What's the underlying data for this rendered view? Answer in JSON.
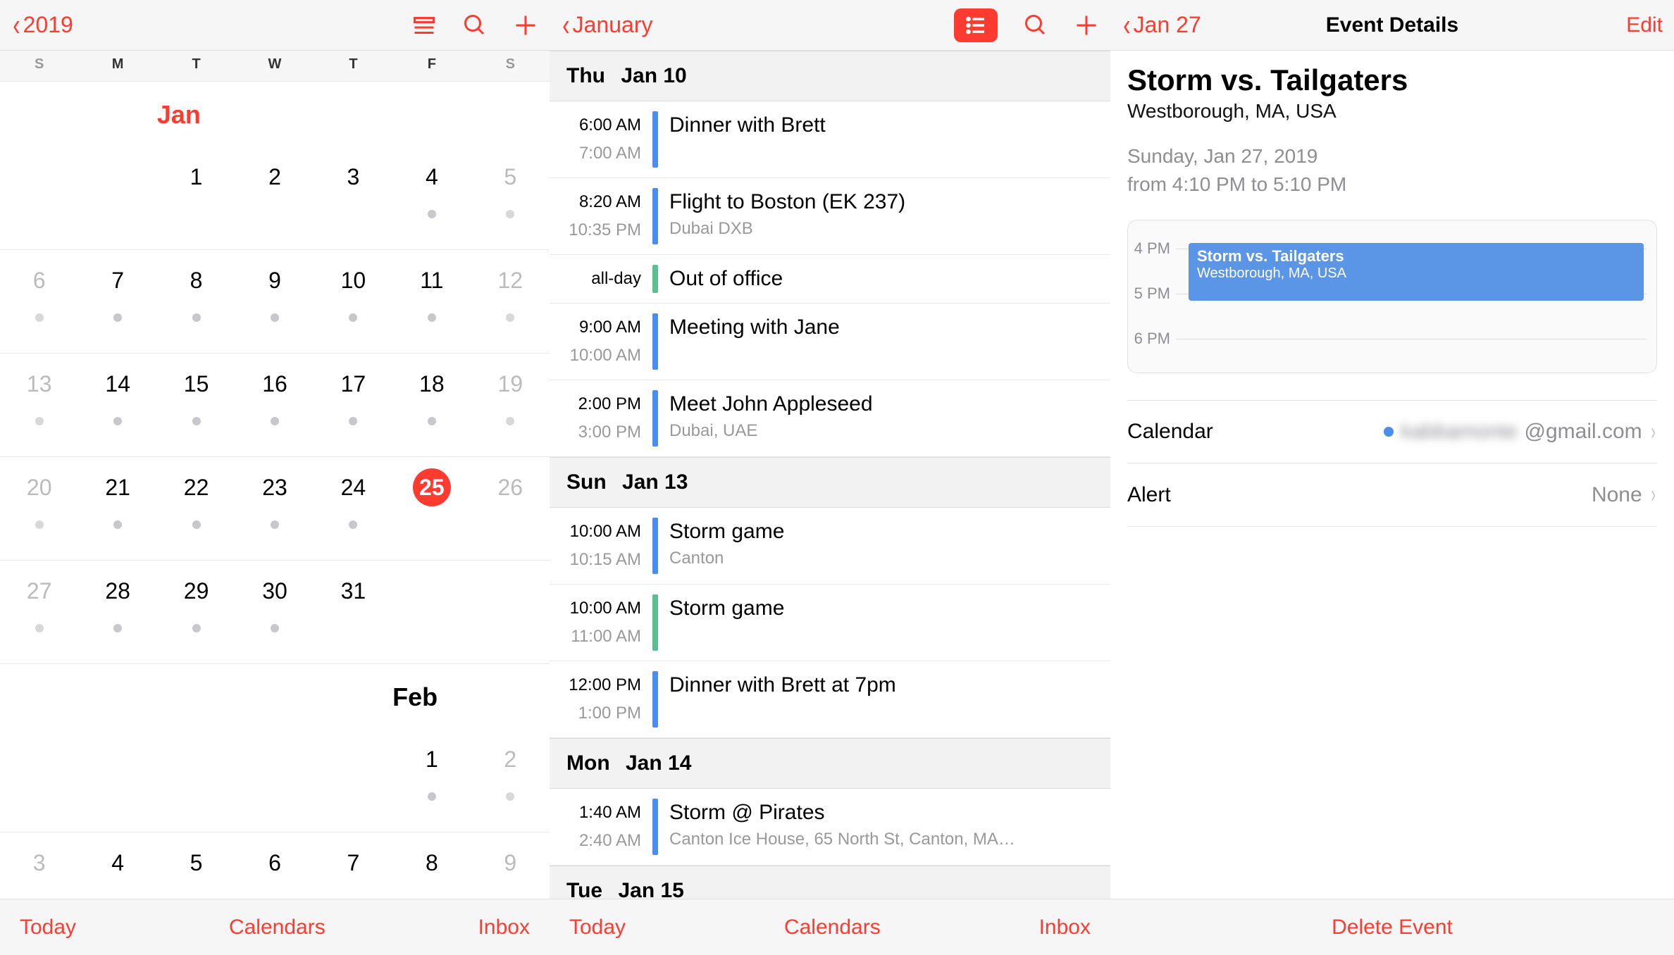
{
  "left": {
    "back": "2019",
    "weekdays": [
      "S",
      "M",
      "T",
      "W",
      "T",
      "F",
      "S"
    ],
    "weekend_idx": [
      0,
      6
    ],
    "months": [
      {
        "label": "Jan",
        "label_col": 2,
        "color": "red",
        "weeks": [
          [
            {
              "n": "",
              "dot": false
            },
            {
              "n": "",
              "dot": false
            },
            {
              "n": "1",
              "dot": false
            },
            {
              "n": "2",
              "dot": false
            },
            {
              "n": "3",
              "dot": false
            },
            {
              "n": "4",
              "dot": true
            },
            {
              "n": "5",
              "dot": true,
              "out": true
            }
          ],
          [
            {
              "n": "6",
              "dot": true,
              "out": true
            },
            {
              "n": "7",
              "dot": true
            },
            {
              "n": "8",
              "dot": true
            },
            {
              "n": "9",
              "dot": true
            },
            {
              "n": "10",
              "dot": true
            },
            {
              "n": "11",
              "dot": true
            },
            {
              "n": "12",
              "dot": true,
              "out": true
            }
          ],
          [
            {
              "n": "13",
              "dot": true,
              "out": true
            },
            {
              "n": "14",
              "dot": true
            },
            {
              "n": "15",
              "dot": true
            },
            {
              "n": "16",
              "dot": true
            },
            {
              "n": "17",
              "dot": true
            },
            {
              "n": "18",
              "dot": true
            },
            {
              "n": "19",
              "dot": true,
              "out": true
            }
          ],
          [
            {
              "n": "20",
              "dot": true,
              "out": true
            },
            {
              "n": "21",
              "dot": true
            },
            {
              "n": "22",
              "dot": true
            },
            {
              "n": "23",
              "dot": true
            },
            {
              "n": "24",
              "dot": true
            },
            {
              "n": "25",
              "dot": false,
              "today": true
            },
            {
              "n": "26",
              "dot": false,
              "out": true
            }
          ],
          [
            {
              "n": "27",
              "dot": true,
              "out": true
            },
            {
              "n": "28",
              "dot": true
            },
            {
              "n": "29",
              "dot": true
            },
            {
              "n": "30",
              "dot": true
            },
            {
              "n": "31",
              "dot": false
            },
            {
              "n": "",
              "dot": false
            },
            {
              "n": "",
              "dot": false
            }
          ]
        ]
      },
      {
        "label": "Feb",
        "label_col": 5,
        "color": "black",
        "weeks": [
          [
            {
              "n": "",
              "dot": false
            },
            {
              "n": "",
              "dot": false
            },
            {
              "n": "",
              "dot": false
            },
            {
              "n": "",
              "dot": false
            },
            {
              "n": "",
              "dot": false
            },
            {
              "n": "1",
              "dot": true
            },
            {
              "n": "2",
              "dot": true,
              "out": true
            }
          ],
          [
            {
              "n": "3",
              "dot": false,
              "out": true
            },
            {
              "n": "4",
              "dot": false
            },
            {
              "n": "5",
              "dot": false
            },
            {
              "n": "6",
              "dot": false
            },
            {
              "n": "7",
              "dot": false
            },
            {
              "n": "8",
              "dot": false
            },
            {
              "n": "9",
              "dot": false,
              "out": true
            }
          ]
        ]
      }
    ],
    "toolbar": {
      "today": "Today",
      "calendars": "Calendars",
      "inbox": "Inbox"
    }
  },
  "mid": {
    "back": "January",
    "sections": [
      {
        "dow": "Thu",
        "date": "Jan 10",
        "events": [
          {
            "t1": "6:00 AM",
            "t2": "7:00 AM",
            "bar": "blue",
            "title": "Dinner with Brett",
            "sub": ""
          },
          {
            "t1": "8:20 AM",
            "t2": "10:35 PM",
            "bar": "blue",
            "title": "Flight to Boston (EK 237)",
            "sub": "Dubai DXB"
          },
          {
            "t1": "all-day",
            "t2": "",
            "bar": "green",
            "title": "Out of office",
            "sub": ""
          },
          {
            "t1": "9:00 AM",
            "t2": "10:00 AM",
            "bar": "blue",
            "title": "Meeting with Jane",
            "sub": ""
          },
          {
            "t1": "2:00 PM",
            "t2": "3:00 PM",
            "bar": "blue",
            "title": "Meet John Appleseed",
            "sub": "Dubai, UAE"
          }
        ]
      },
      {
        "dow": "Sun",
        "date": "Jan 13",
        "events": [
          {
            "t1": "10:00 AM",
            "t2": "10:15 AM",
            "bar": "blue",
            "title": "Storm game",
            "sub": "Canton"
          },
          {
            "t1": "10:00 AM",
            "t2": "11:00 AM",
            "bar": "green",
            "title": "Storm game",
            "sub": ""
          },
          {
            "t1": "12:00 PM",
            "t2": "1:00 PM",
            "bar": "blue",
            "title": "Dinner with Brett at 7pm",
            "sub": ""
          }
        ]
      },
      {
        "dow": "Mon",
        "date": "Jan 14",
        "events": [
          {
            "t1": "1:40 AM",
            "t2": "2:40 AM",
            "bar": "blue",
            "title": "Storm @ Pirates",
            "sub": "Canton Ice House, 65 North St, Canton, MA…"
          }
        ]
      },
      {
        "dow": "Tue",
        "date": "Jan 15",
        "events": []
      }
    ],
    "toolbar": {
      "today": "Today",
      "calendars": "Calendars",
      "inbox": "Inbox"
    }
  },
  "right": {
    "back": "Jan 27",
    "title": "Event Details",
    "edit": "Edit",
    "event": {
      "title": "Storm vs. Tailgaters",
      "location": "Westborough, MA, USA",
      "date": "Sunday, Jan 27, 2019",
      "time": "from 4:10 PM to 5:10 PM"
    },
    "timeline": {
      "hours": [
        "4 PM",
        "5 PM",
        "6 PM"
      ],
      "block_title": "Storm vs. Tailgaters",
      "block_sub": "Westborough, MA, USA"
    },
    "rows": {
      "calendar_label": "Calendar",
      "calendar_value_prefix": "kabbamonte",
      "calendar_value_suffix": "@gmail.com",
      "alert_label": "Alert",
      "alert_value": "None"
    },
    "delete": "Delete Event"
  }
}
